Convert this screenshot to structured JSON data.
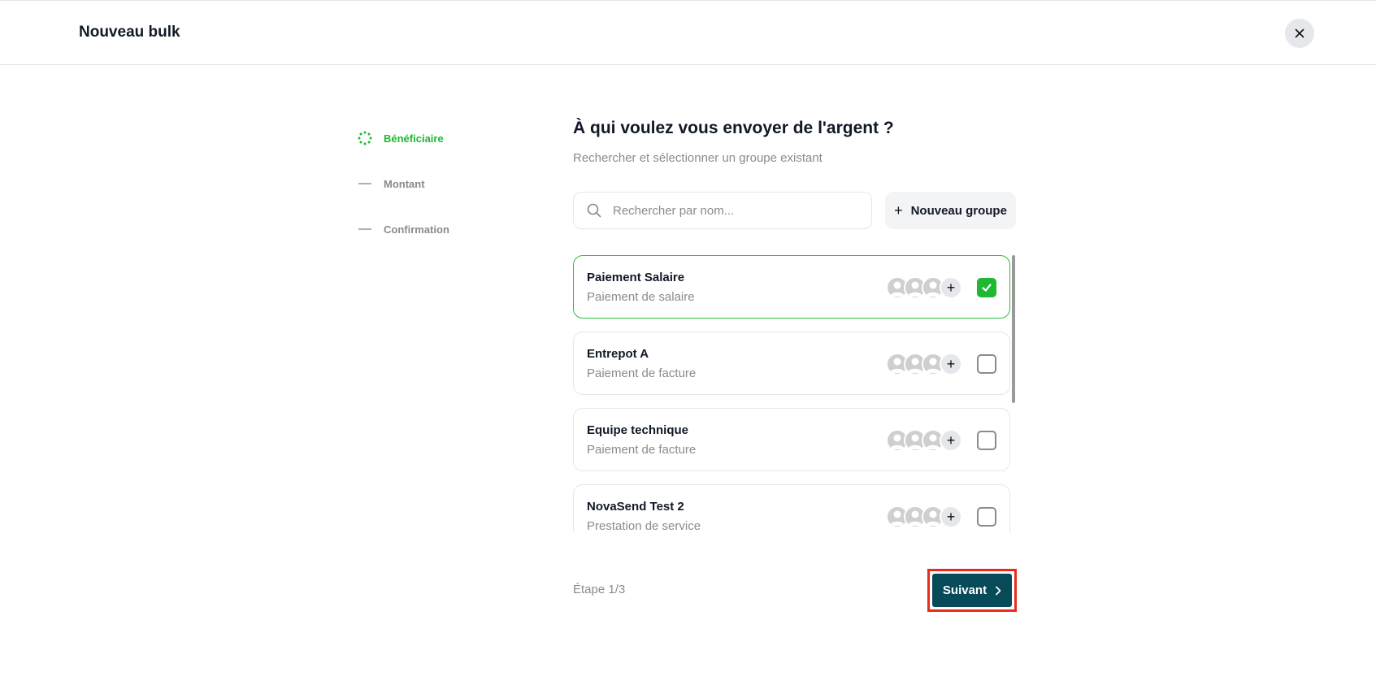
{
  "header": {
    "title": "Nouveau bulk",
    "close_icon": "close-icon"
  },
  "stepper": {
    "steps": [
      {
        "label": "Bénéficiaire",
        "state": "active",
        "icon": "loading-dots-icon"
      },
      {
        "label": "Montant",
        "state": "pending",
        "icon": "dash-icon"
      },
      {
        "label": "Confirmation",
        "state": "pending",
        "icon": "dash-icon"
      }
    ]
  },
  "main": {
    "title": "À qui voulez vous envoyer de l'argent ?",
    "subtitle": "Rechercher et sélectionner un groupe existant",
    "search": {
      "placeholder": "Rechercher par nom...",
      "value": "",
      "icon": "search-icon"
    },
    "new_group_label": "Nouveau groupe",
    "groups": [
      {
        "name": "Paiement Salaire",
        "description": "Paiement de salaire",
        "selected": true,
        "more": "+"
      },
      {
        "name": "Entrepot A",
        "description": "Paiement de facture",
        "selected": false,
        "more": "+"
      },
      {
        "name": "Equipe technique",
        "description": "Paiement de facture",
        "selected": false,
        "more": "+"
      },
      {
        "name": "NovaSend Test 2",
        "description": "Prestation de service",
        "selected": false,
        "more": "+"
      }
    ]
  },
  "footer": {
    "step_text": "Étape 1/3",
    "next_label": "Suivant"
  },
  "colors": {
    "accent_green": "#1fb832",
    "primary_button": "#074a5a",
    "highlight_border": "#ea2a1a"
  }
}
